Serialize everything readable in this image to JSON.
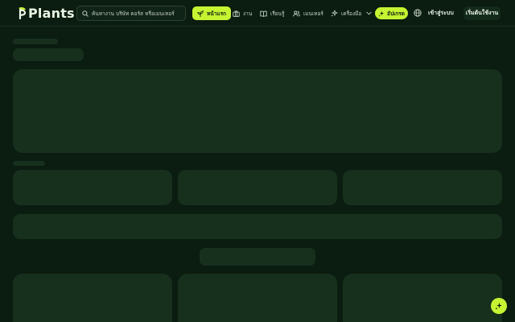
{
  "brand": {
    "name": "Plants",
    "logo_color": "#c6f432"
  },
  "search": {
    "placeholder": "ค้นหางาน บริษัท คอร์ส หรือเมนเทอร์",
    "icon": "search-icon"
  },
  "nav": {
    "items": [
      {
        "label": "หน้าแรก",
        "icon": "sprout-icon",
        "active": true
      },
      {
        "label": "งาน",
        "icon": "briefcase-icon",
        "active": false
      },
      {
        "label": "เรียนรู้",
        "icon": "book-icon",
        "active": false
      },
      {
        "label": "เมนเทอร์",
        "icon": "users-icon",
        "active": false
      },
      {
        "label": "เครื่องมือ",
        "icon": "sparkle-icon",
        "active": false
      }
    ],
    "cta_label": "อัปเกรด",
    "language_icon": "globe-icon",
    "login_label": "เข้าสู่ระบบ",
    "start_label": "เริ่มต้นใช้งาน"
  },
  "colors": {
    "background": "#0b1c10",
    "skeleton": "#17301d",
    "accent": "#c6f432"
  },
  "floating_button": {
    "icon": "sparkle-icon"
  }
}
